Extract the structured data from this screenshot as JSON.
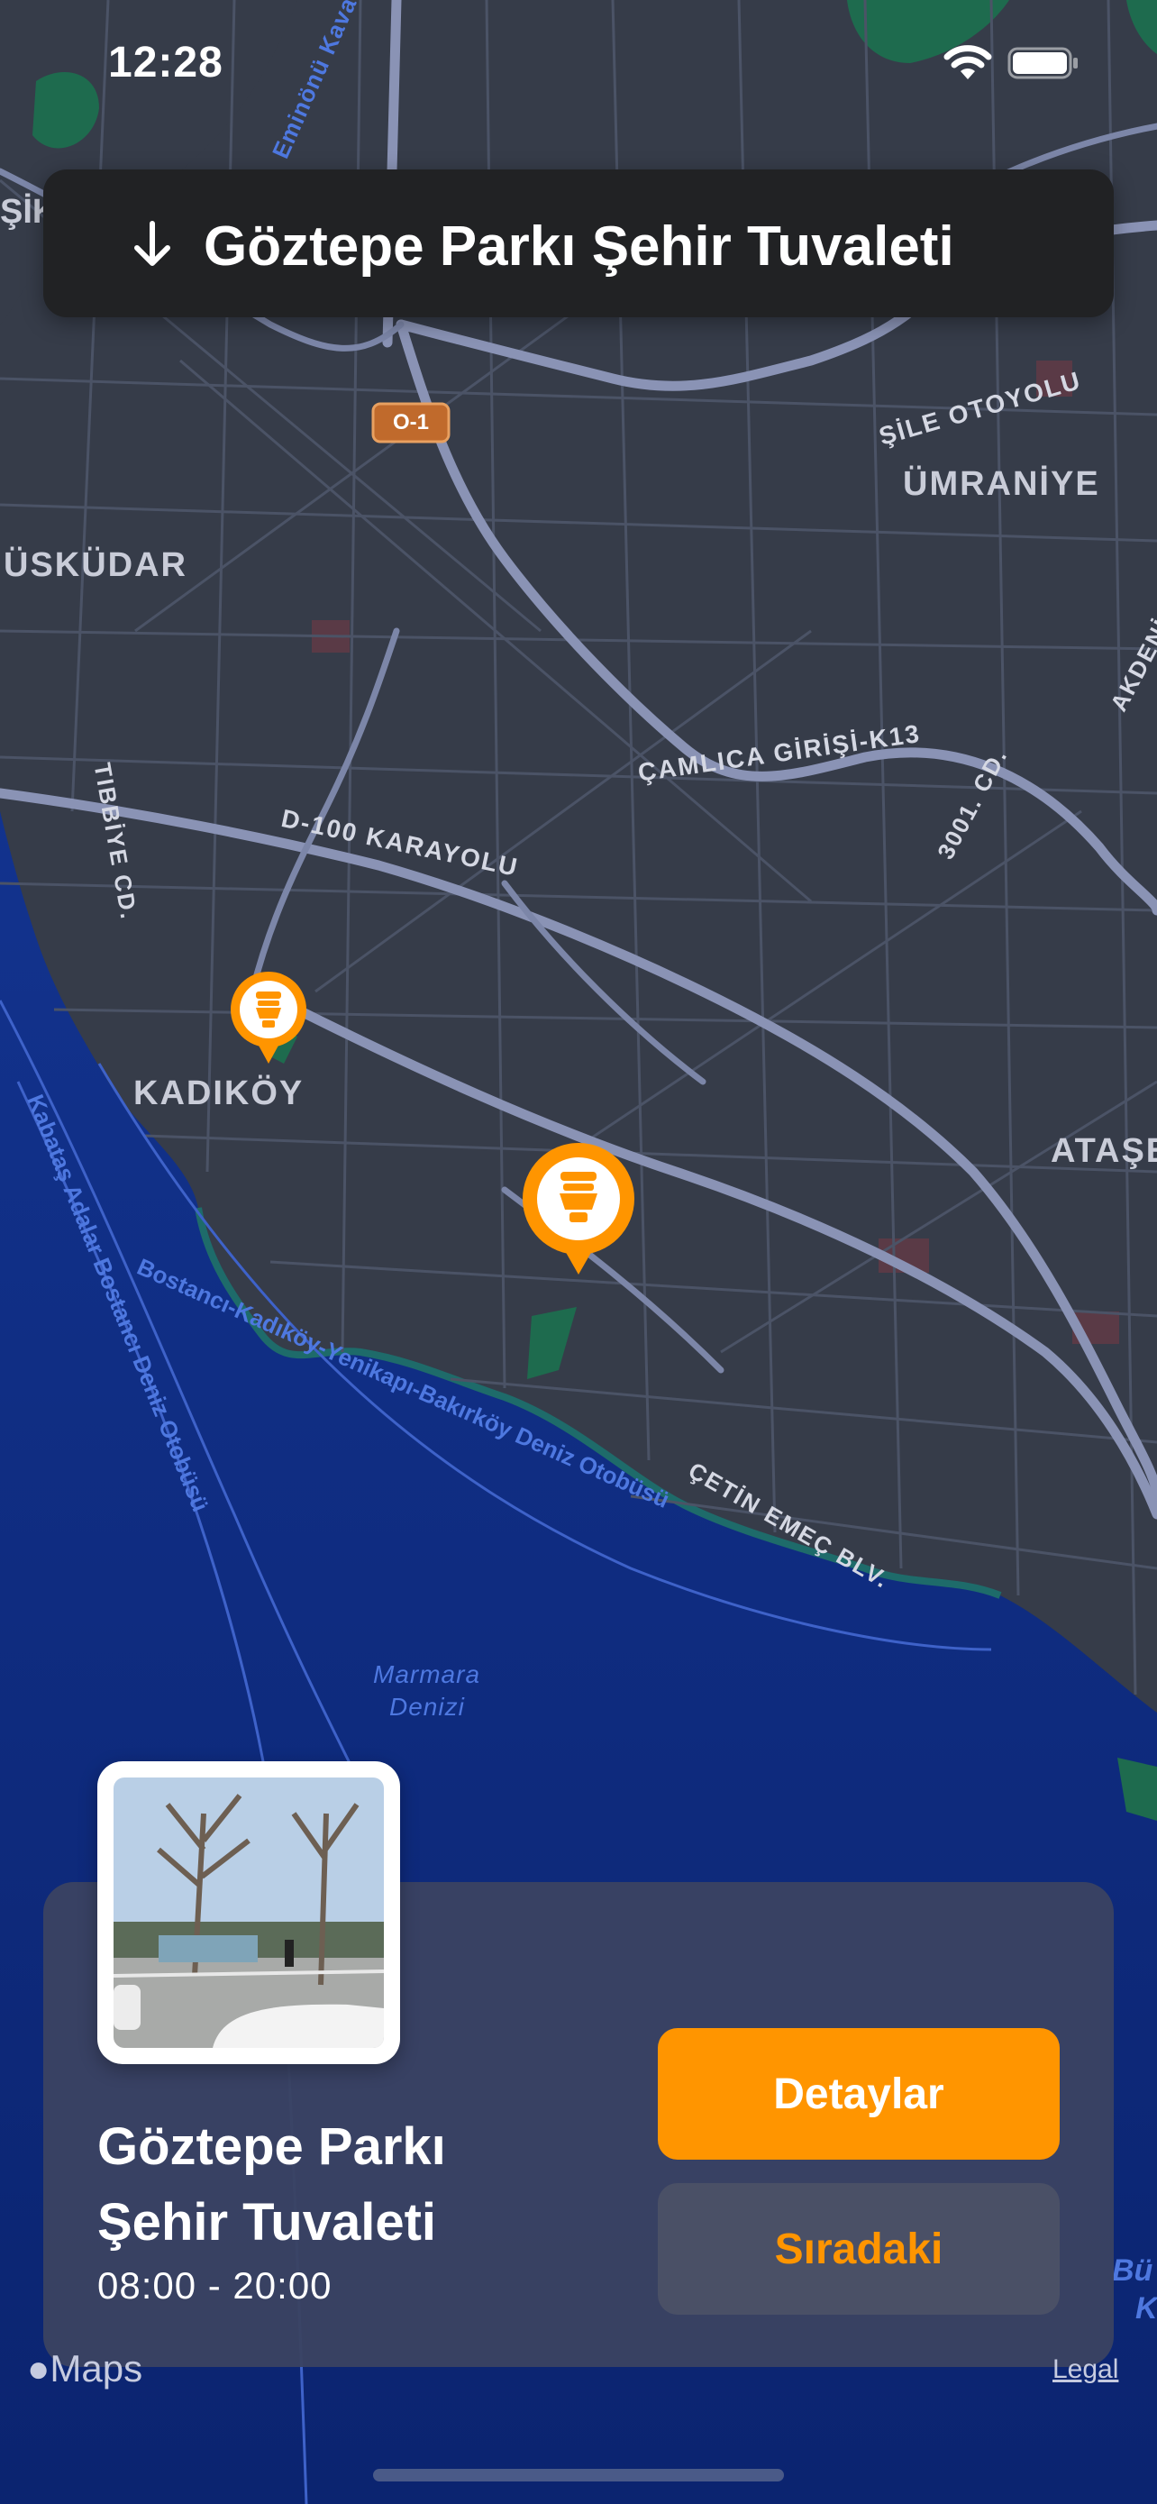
{
  "status_bar": {
    "time": "12:28"
  },
  "search_bar": {
    "title": "Göztepe Parkı Şehir Tuvaleti"
  },
  "map": {
    "places": [
      "ÜSKÜDAR",
      "ÜMRANİYE",
      "KADIKÖY",
      "ATAŞE"
    ],
    "roads": [
      "D-100 KARAYOLU",
      "ÇAMLICA GİRİŞİ-K13",
      "ŞİLE OTOYOLU",
      "TIBBİYE CD.",
      "3001. CD.",
      "ÇETİN EMEÇ BLV.",
      "AKDENİ",
      "Eminönü Kava"
    ],
    "ferry_routes": [
      "Bostancı-Kadıköy-Yenikapı-Bakırköy Deniz Otobüsü",
      "Kabataş Adalar Bostancı Deniz Otobüsü"
    ],
    "water": {
      "line1": "Marmara",
      "line2": "Denizi"
    },
    "highway_shield": "O-1",
    "partial_labels": [
      "ŞİK",
      "Bü",
      "K",
      "O-1"
    ]
  },
  "card": {
    "name": "Göztepe Parkı Şehir Tuvaleti",
    "name_line1": "Göztepe Parkı",
    "name_line2": "Şehir Tuvaleti",
    "hours": "08:00 - 20:00",
    "details_label": "Detaylar",
    "next_label": "Sıradaki"
  },
  "footer": {
    "maps_label": "Maps",
    "legal_label": "Legal"
  },
  "colors": {
    "accent": "#ff9500",
    "land": "#363c49",
    "water": "#0f2e8c",
    "road": "#8a93b5",
    "card": "#3a4362"
  },
  "icons": [
    "wifi-icon",
    "battery-icon",
    "arrow-down-icon",
    "toilet-icon",
    "apple-logo-icon"
  ]
}
